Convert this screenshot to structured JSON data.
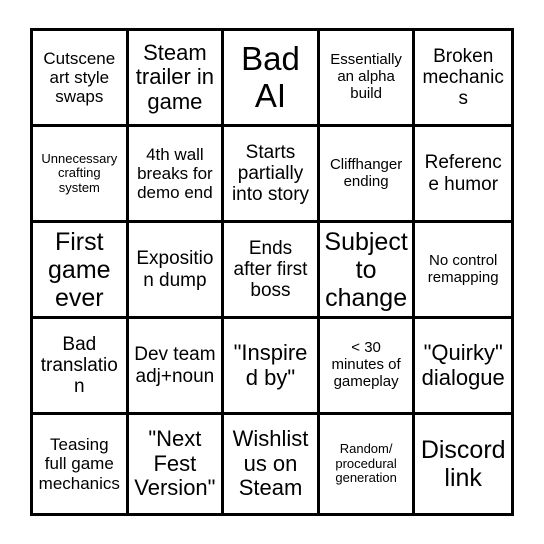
{
  "card": {
    "type": "bingo-card",
    "columns": 5,
    "rows": 5,
    "background_color": "#ffffff",
    "border_color": "#000000",
    "text_color": "#000000",
    "cells": [
      {
        "text": "Cutscene art style swaps",
        "size": "sm"
      },
      {
        "text": "Steam trailer in game",
        "size": "lg"
      },
      {
        "text": "Bad AI",
        "size": "xxl"
      },
      {
        "text": "Essentially an alpha build",
        "size": "xs"
      },
      {
        "text": "Broken mechanics",
        "size": "md"
      },
      {
        "text": "Unnecessary crafting system",
        "size": "xxs"
      },
      {
        "text": "4th wall breaks for demo end",
        "size": "sm"
      },
      {
        "text": "Starts partially into story",
        "size": "md"
      },
      {
        "text": "Cliffhanger ending",
        "size": "xs"
      },
      {
        "text": "Reference humor",
        "size": "md"
      },
      {
        "text": "First game ever",
        "size": "xl"
      },
      {
        "text": "Exposition dump",
        "size": "md"
      },
      {
        "text": "Ends after first boss",
        "size": "md"
      },
      {
        "text": "Subject to change",
        "size": "xl"
      },
      {
        "text": "No control remapping",
        "size": "xs"
      },
      {
        "text": "Bad translation",
        "size": "md"
      },
      {
        "text": "Dev team adj+noun",
        "size": "md"
      },
      {
        "text": "\"Inspired by\"",
        "size": "lg"
      },
      {
        "text": "< 30 minutes of gameplay",
        "size": "xs"
      },
      {
        "text": "\"Quirky\" dialogue",
        "size": "lg"
      },
      {
        "text": "Teasing full game mechanics",
        "size": "sm"
      },
      {
        "text": "\"Next Fest Version\"",
        "size": "lg"
      },
      {
        "text": "Wishlist us on Steam",
        "size": "lg"
      },
      {
        "text": "Random/ procedural generation",
        "size": "xxs"
      },
      {
        "text": "Discord link",
        "size": "xl"
      }
    ]
  }
}
